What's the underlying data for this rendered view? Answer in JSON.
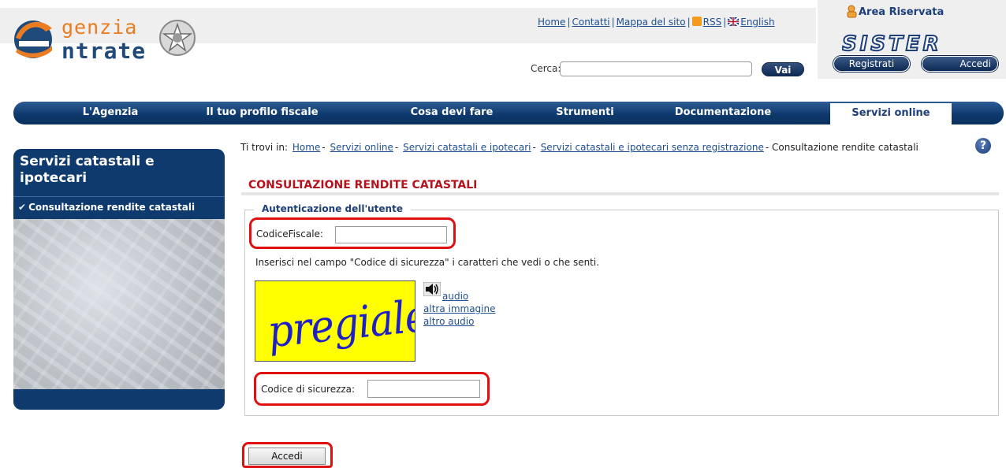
{
  "header": {
    "logo_line1": "genzia",
    "logo_line2": "ntrate",
    "toplinks": {
      "home": "Home",
      "contatti": "Contatti",
      "mappa": "Mappa del sito",
      "rss": "RSS",
      "english": "English"
    },
    "search": {
      "label": "Cerca:",
      "value": "",
      "button": "Vai"
    },
    "area_riservata": {
      "title": "Area Riservata",
      "sister_logo": "SISTER",
      "registrati": "Registrati",
      "accedi": "Accedi"
    }
  },
  "nav": {
    "items": [
      "L'Agenzia",
      "Il tuo profilo fiscale",
      "Cosa devi fare",
      "Strumenti",
      "Documentazione",
      "Servizi online"
    ],
    "active": "Servizi online"
  },
  "sidebar": {
    "title": "Servizi catastali e ipotecari",
    "item": "Consultazione rendite catastali"
  },
  "breadcrumb": {
    "prefix": "Ti trovi in:",
    "links": [
      "Home",
      "Servizi online",
      "Servizi catastali e ipotecari",
      "Servizi catastali e ipotecari senza registrazione"
    ],
    "current": "Consultazione rendite catastali",
    "separator": "-"
  },
  "main": {
    "title": "CONSULTAZIONE RENDITE CATASTALI",
    "legend": "Autenticazione dell'utente",
    "codice_fiscale_label": "CodiceFiscale:",
    "codice_fiscale_value": "",
    "captcha_instructions": "Inserisci nel campo \"Codice di sicurezza\" i caratteri che vedi o che senti.",
    "captcha_text": "pregiale",
    "captcha_links": {
      "audio": "audio",
      "altra_immagine": "altra immagine",
      "altro_audio": "altro audio"
    },
    "codice_sicurezza_label": "Codice di sicurezza:",
    "codice_sicurezza_value": "",
    "submit": "Accedi"
  },
  "colors": {
    "brand_blue": "#0f3a6e",
    "brand_orange": "#ea7c22",
    "title_red": "#b5121b",
    "highlight_red": "#e01010",
    "captcha_yellow": "#ffff00"
  }
}
